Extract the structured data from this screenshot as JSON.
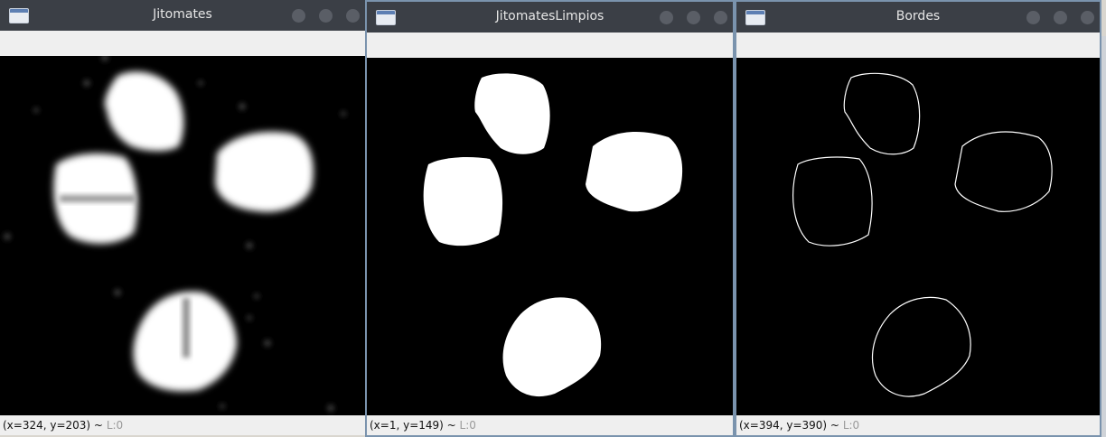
{
  "windows": [
    {
      "title": "Jitomates",
      "status_coords": "(x=324, y=203) ~",
      "status_level": "L:0"
    },
    {
      "title": "JitomatesLimpios",
      "status_coords": "(x=1, y=149) ~",
      "status_level": "L:0"
    },
    {
      "title": "Bordes",
      "status_coords": "(x=394, y=390) ~",
      "status_level": "L:0"
    }
  ],
  "colors": {
    "titlebar": "#3b3f46",
    "frame": "#7a93ad",
    "status_bar": "#efefef"
  }
}
